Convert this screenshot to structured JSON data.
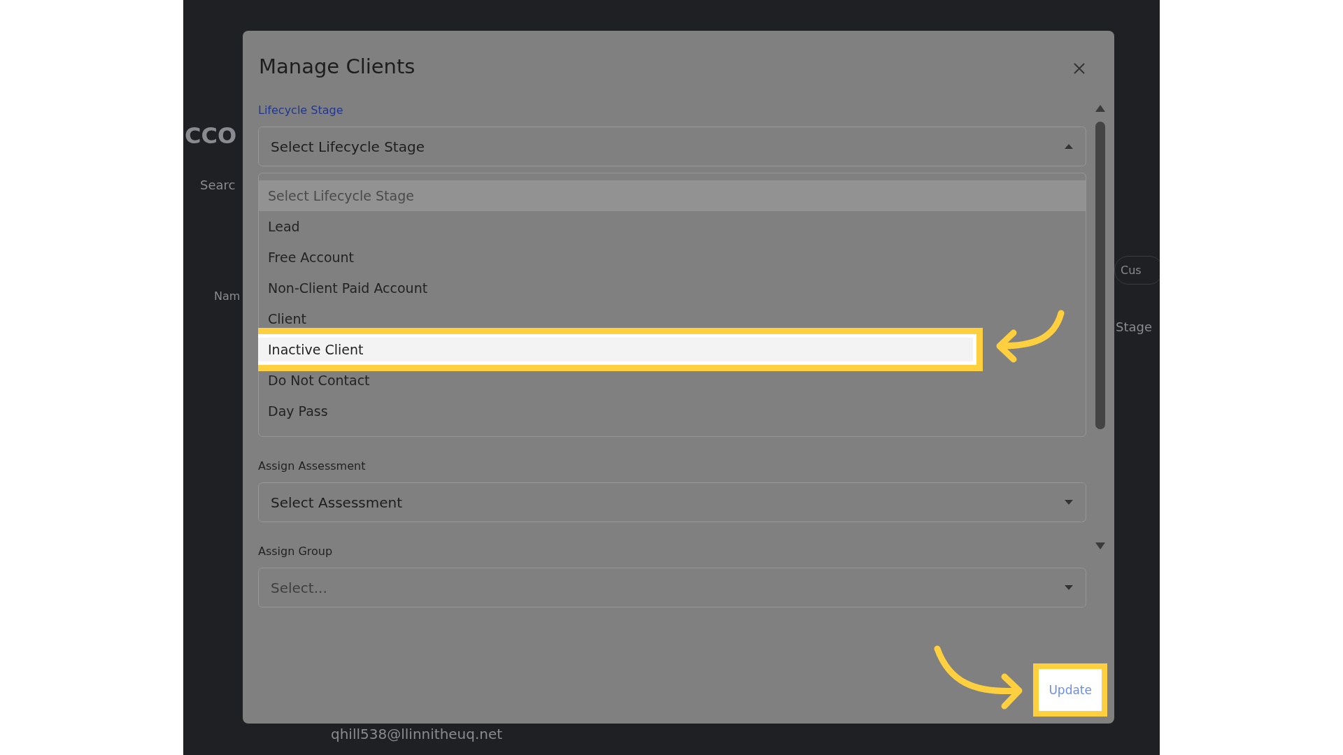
{
  "background": {
    "heading": "CCO",
    "search": {
      "placeholder": "Searc"
    },
    "column_1": "Nam",
    "filter_button": "Cus",
    "column_2": "Stage",
    "email": "qhill538@llinnitheuq.net"
  },
  "modal": {
    "title": "Manage Clients",
    "fields": [
      {
        "label": "Lifecycle Stage",
        "value": "Select Lifecycle Stage",
        "expanded": true,
        "options": [
          {
            "label": "Select Lifecycle Stage",
            "disabled": true,
            "selected": true,
            "highlighted": false,
            "annotated": false
          },
          {
            "label": "Lead",
            "disabled": false,
            "selected": false,
            "highlighted": false,
            "annotated": false
          },
          {
            "label": "Free Account",
            "disabled": false,
            "selected": false,
            "highlighted": false,
            "annotated": false
          },
          {
            "label": "Non-Client Paid Account",
            "disabled": false,
            "selected": false,
            "highlighted": false,
            "annotated": false
          },
          {
            "label": "Client",
            "disabled": false,
            "selected": false,
            "highlighted": false,
            "annotated": false
          },
          {
            "label": "Inactive Client",
            "disabled": false,
            "selected": false,
            "highlighted": true,
            "annotated": true
          },
          {
            "label": "Do Not Contact",
            "disabled": false,
            "selected": false,
            "highlighted": false,
            "annotated": false
          },
          {
            "label": "Day Pass",
            "disabled": false,
            "selected": false,
            "highlighted": false,
            "annotated": false
          }
        ]
      },
      {
        "label": "Assign Assessment",
        "value": "Select Assessment",
        "expanded": false
      },
      {
        "label": "Assign Group",
        "placeholder": "Select...",
        "expanded": false
      }
    ],
    "buttons": [
      {
        "label": "Update",
        "annotated": true
      }
    ]
  }
}
